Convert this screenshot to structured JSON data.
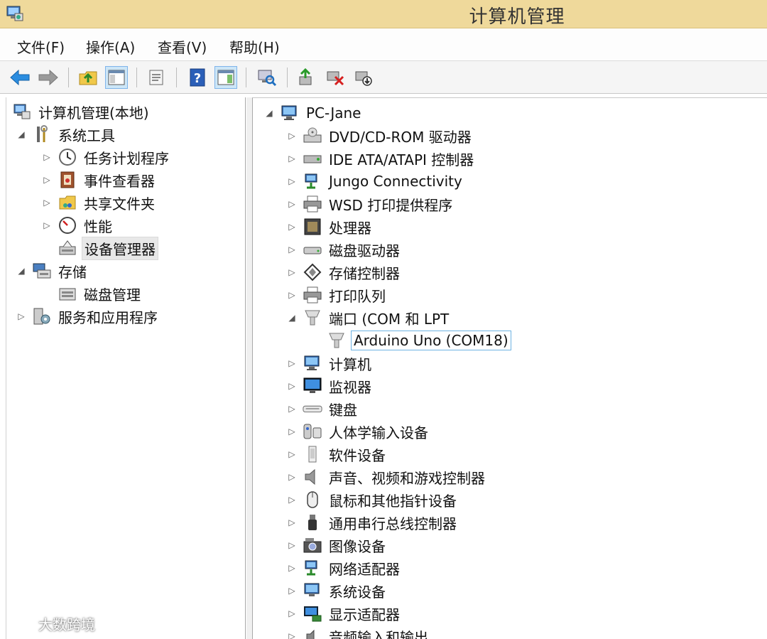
{
  "window": {
    "title": "计算机管理"
  },
  "menu": [
    "文件(F)",
    "操作(A)",
    "查看(V)",
    "帮助(H)"
  ],
  "left_tree": [
    {
      "label": "计算机管理(本地)",
      "icon": "computer-management-icon",
      "expander": ""
    },
    {
      "label": "系统工具",
      "icon": "tools-icon",
      "expander": "◢"
    },
    {
      "label": "任务计划程序",
      "icon": "clock-icon",
      "expander": "▷"
    },
    {
      "label": "事件查看器",
      "icon": "event-viewer-icon",
      "expander": "▷"
    },
    {
      "label": "共享文件夹",
      "icon": "shared-folder-icon",
      "expander": "▷"
    },
    {
      "label": "性能",
      "icon": "performance-icon",
      "expander": "▷"
    },
    {
      "label": "设备管理器",
      "icon": "device-manager-icon",
      "expander": ""
    },
    {
      "label": "存储",
      "icon": "storage-icon",
      "expander": "◢"
    },
    {
      "label": "磁盘管理",
      "icon": "disk-management-icon",
      "expander": ""
    },
    {
      "label": "服务和应用程序",
      "icon": "services-icon",
      "expander": "▷"
    }
  ],
  "device_tree": [
    {
      "label": "PC-Jane",
      "icon": "computer-icon",
      "expander": "◢"
    },
    {
      "label": "DVD/CD-ROM 驱动器",
      "icon": "dvd-drive-icon",
      "expander": "▷"
    },
    {
      "label": "IDE ATA/ATAPI 控制器",
      "icon": "ide-controller-icon",
      "expander": "▷"
    },
    {
      "label": "Jungo Connectivity",
      "icon": "network-device-icon",
      "expander": "▷"
    },
    {
      "label": "WSD 打印提供程序",
      "icon": "printer-icon",
      "expander": "▷"
    },
    {
      "label": "处理器",
      "icon": "processor-icon",
      "expander": "▷"
    },
    {
      "label": "磁盘驱动器",
      "icon": "disk-drive-icon",
      "expander": "▷"
    },
    {
      "label": "存储控制器",
      "icon": "storage-controller-icon",
      "expander": "▷"
    },
    {
      "label": "打印队列",
      "icon": "printer-icon",
      "expander": "▷"
    },
    {
      "label": "端口 (COM 和 LPT",
      "icon": "port-icon",
      "expander": "◢"
    },
    {
      "label": "Arduino Uno (COM18)",
      "icon": "port-icon",
      "expander": ""
    },
    {
      "label": "计算机",
      "icon": "computer-icon",
      "expander": "▷"
    },
    {
      "label": "监视器",
      "icon": "monitor-icon",
      "expander": "▷"
    },
    {
      "label": "键盘",
      "icon": "keyboard-icon",
      "expander": "▷"
    },
    {
      "label": "人体学输入设备",
      "icon": "hid-icon",
      "expander": "▷"
    },
    {
      "label": "软件设备",
      "icon": "software-device-icon",
      "expander": "▷"
    },
    {
      "label": "声音、视频和游戏控制器",
      "icon": "speaker-icon",
      "expander": "▷"
    },
    {
      "label": "鼠标和其他指针设备",
      "icon": "mouse-icon",
      "expander": "▷"
    },
    {
      "label": "通用串行总线控制器",
      "icon": "usb-icon",
      "expander": "▷"
    },
    {
      "label": "图像设备",
      "icon": "camera-icon",
      "expander": "▷"
    },
    {
      "label": "网络适配器",
      "icon": "network-adapter-icon",
      "expander": "▷"
    },
    {
      "label": "系统设备",
      "icon": "system-device-icon",
      "expander": "▷"
    },
    {
      "label": "显示适配器",
      "icon": "display-adapter-icon",
      "expander": "▷"
    },
    {
      "label": "音频输入和输出",
      "icon": "audio-icon",
      "expander": "▷"
    }
  ],
  "watermark": "大数跨境",
  "colors": {
    "titlebar": "#efd99b",
    "selection_border": "#6fb3e3",
    "toolbar_active": "#cde6f7"
  }
}
